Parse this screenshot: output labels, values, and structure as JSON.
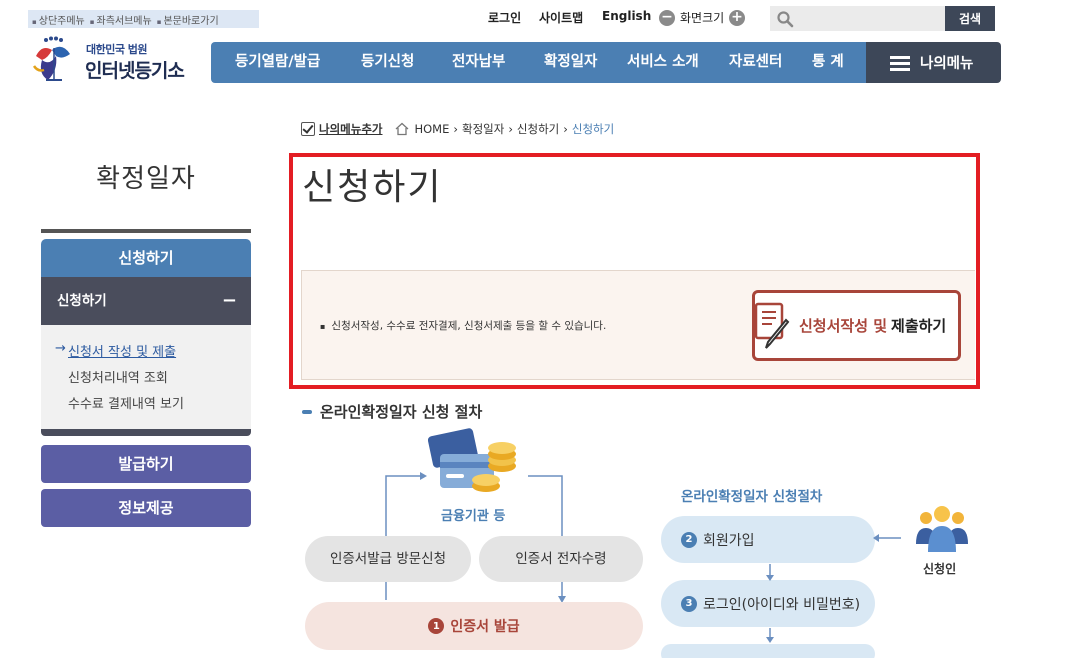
{
  "skip_links": [
    "상단주메뉴",
    "좌측서브메뉴",
    "본문바로가기"
  ],
  "util": {
    "login": "로그인",
    "sitemap": "사이트맵",
    "english": "English",
    "zoom_label": "화면크기",
    "zoom_out": "−",
    "zoom_in": "+",
    "search_placeholder": "",
    "search_button": "검색"
  },
  "logo": {
    "small": "대한민국 법원",
    "big": "인터넷등기소"
  },
  "gnb": [
    "등기열람/발급",
    "등기신청",
    "전자납부",
    "확정일자",
    "서비스 소개",
    "자료센터",
    "통 계"
  ],
  "my_menu": "나의메뉴",
  "breadcrumb": {
    "add": "나의메뉴추가",
    "items": [
      "HOME",
      "확정일자",
      "신청하기"
    ],
    "current": "신청하기"
  },
  "sidebar": {
    "title": "확정일자",
    "section1": "신청하기",
    "section1_sub": "신청하기",
    "collapse": "−",
    "links": [
      "신청서 작성 및 제출",
      "신청처리내역 조회",
      "수수료 결제내역 보기"
    ],
    "section2": "발급하기",
    "section3": "정보제공"
  },
  "main": {
    "title": "신청하기",
    "info": "신청서작성, 수수료 전자결제, 신청서제출 등을 할 수 있습니다.",
    "apply_red": "신청서작성 및",
    "apply_black": "제출하기"
  },
  "procedure": {
    "title": "온라인확정일자 신청 절차",
    "bank_label": "금융기관 등",
    "visit": "인증서발급 방문신청",
    "receive": "인증서 전자수령",
    "step1_num": "1",
    "step1": "인증서 발급",
    "right_title": "온라인확정일자 신청절차",
    "step2_num": "2",
    "step2": "회원가입",
    "step3_num": "3",
    "step3": "로그인(아이디와 비밀번호)",
    "applicant": "신청인"
  },
  "colors": {
    "primary": "#4b7fb3",
    "dark": "#3d4758",
    "highlight": "#e31d23",
    "accent_red": "#a8453a",
    "purple": "#5b5ea4"
  }
}
